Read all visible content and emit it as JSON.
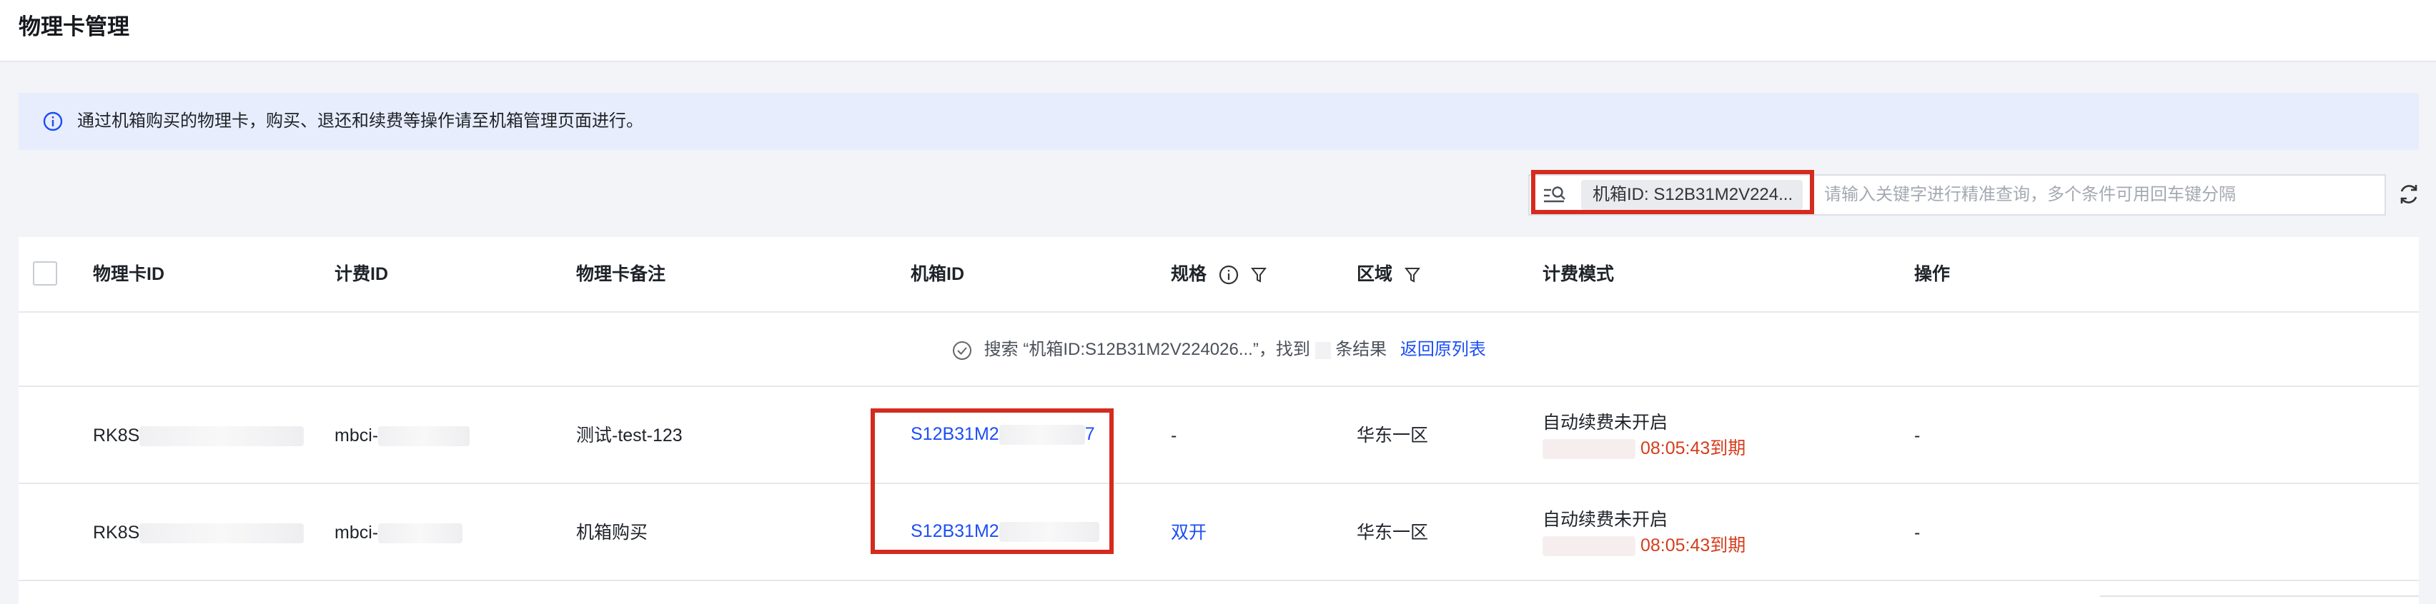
{
  "page": {
    "title": "物理卡管理"
  },
  "notice": {
    "text": "通过机箱购买的物理卡，购买、退还和续费等操作请至机箱管理页面进行。"
  },
  "search": {
    "tag": "机箱ID: S12B31M2V224...",
    "placeholder": "请输入关键字进行精准查询，多个条件可用回车键分隔"
  },
  "table": {
    "columns": {
      "card_id": "物理卡ID",
      "billing_id": "计费ID",
      "remark": "物理卡备注",
      "chassis_id": "机箱ID",
      "spec": "规格",
      "region": "区域",
      "billing_mode": "计费模式",
      "actions": "操作"
    },
    "result_prefix": "搜索 “机箱ID:S12B31M2V224026...”，找到",
    "result_suffix": "条结果",
    "back_link": "返回原列表",
    "rows": [
      {
        "card_id": "RK8S",
        "billing_id": "mbci-",
        "remark": "测试-test-123",
        "chassis_id": "S12B31M2",
        "chassis_tail": "7",
        "spec": "-",
        "region": "华东一区",
        "renew": "自动续费未开启",
        "expire": "08:05:43到期",
        "action": "-"
      },
      {
        "card_id": "RK8S",
        "billing_id": "mbci-",
        "remark": "机箱购买",
        "chassis_id": "S12B31M2",
        "chassis_tail": "",
        "spec": "双开",
        "region": "华东一区",
        "renew": "自动续费未开启",
        "expire": "08:05:43到期",
        "action": "-"
      }
    ]
  },
  "colors": {
    "link": "#1c4ef5",
    "expire": "#d53d1c",
    "highlight": "#d52b1e",
    "notice_bg": "#e8edfd"
  }
}
